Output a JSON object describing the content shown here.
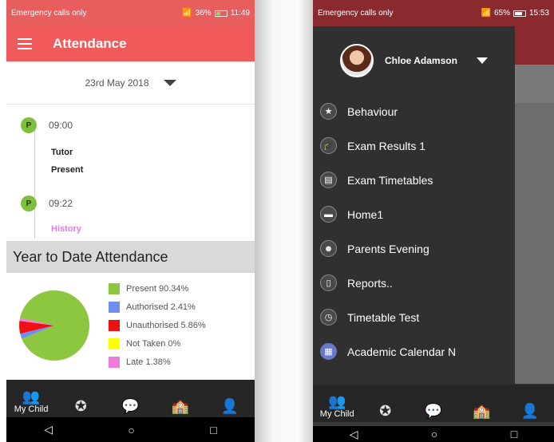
{
  "left": {
    "status": {
      "left": "Emergency calls only",
      "right": "36%",
      "time": "11:49"
    },
    "title": "Attendance",
    "date": "23rd May 2018",
    "timeline": [
      {
        "badge": "P",
        "time": "09:00",
        "line1": "Tutor",
        "line2": "Present"
      },
      {
        "badge": "P",
        "time": "09:22",
        "link": "History"
      }
    ],
    "ytd_heading": "Year to Date Attendance",
    "legend": [
      {
        "label": "Present 90.34%",
        "color": "#8dc63f"
      },
      {
        "label": "Authorised 2.41%",
        "color": "#6f8ff0"
      },
      {
        "label": "Unauthorised 5.86%",
        "color": "#ee1111"
      },
      {
        "label": "Not Taken 0%",
        "color": "#ffff00"
      },
      {
        "label": "Late 1.38%",
        "color": "#f27ad8"
      }
    ],
    "bottom_nav": {
      "my_child": "My Child"
    }
  },
  "chart_data": {
    "type": "pie",
    "categories": [
      "Present",
      "Authorised",
      "Unauthorised",
      "Not Taken",
      "Late"
    ],
    "values": [
      90.34,
      2.41,
      5.86,
      0,
      1.38
    ],
    "colors": [
      "#8dc63f",
      "#6f8ff0",
      "#ee1111",
      "#ffff00",
      "#f27ad8"
    ],
    "title": "Year to Date Attendance"
  },
  "right": {
    "status": {
      "left": "Emergency calls only",
      "right": "65%",
      "time": "15:53"
    },
    "profile_name": "Chloe Adamson",
    "menu": [
      {
        "label": "Behaviour",
        "icon": "star-icon"
      },
      {
        "label": "Exam Results 1",
        "icon": "graduation-cap-icon"
      },
      {
        "label": "Exam Timetables",
        "icon": "list-icon"
      },
      {
        "label": "Home1",
        "icon": "briefcase-icon"
      },
      {
        "label": "Parents Evening",
        "icon": "people-icon"
      },
      {
        "label": "Reports..",
        "icon": "document-icon"
      },
      {
        "label": "Timetable Test",
        "icon": "clock-icon"
      },
      {
        "label": "Academic Calendar N",
        "icon": "calendar-icon"
      }
    ],
    "bottom_nav": {
      "my_child": "My Child"
    }
  }
}
